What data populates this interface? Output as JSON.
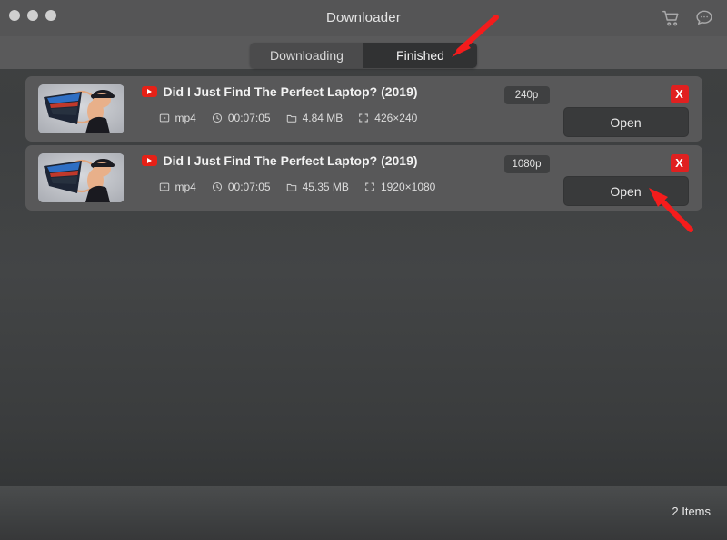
{
  "window": {
    "title": "Downloader",
    "traffic_lights": [
      "close",
      "minimize",
      "maximize"
    ],
    "actions": [
      {
        "name": "cart-icon",
        "label": "Cart"
      },
      {
        "name": "chat-icon",
        "label": "Chat"
      }
    ]
  },
  "tabs": [
    {
      "id": "downloading",
      "label": "Downloading",
      "active": false
    },
    {
      "id": "finished",
      "label": "Finished",
      "active": true
    }
  ],
  "downloads": [
    {
      "title": "Did I Just Find The Perfect Laptop? (2019)",
      "source": "youtube",
      "format": "mp4",
      "duration": "00:07:05",
      "size": "4.84 MB",
      "resolution": "426×240",
      "quality": "240p",
      "open_label": "Open",
      "close_label": "X"
    },
    {
      "title": "Did I Just Find The Perfect Laptop? (2019)",
      "source": "youtube",
      "format": "mp4",
      "duration": "00:07:05",
      "size": "45.35 MB",
      "resolution": "1920×1080",
      "quality": "1080p",
      "open_label": "Open",
      "close_label": "X"
    }
  ],
  "statusbar": {
    "item_count": "2 Items"
  },
  "annotations": [
    {
      "name": "arrow-to-finished-tab",
      "color": "#f41c1c"
    },
    {
      "name": "arrow-to-open-button",
      "color": "#f41c1c"
    }
  ],
  "colors": {
    "accent_red": "#e02020",
    "youtube_red": "#e62117",
    "titlebar": "#555556",
    "tabbar": "#5a5a5b",
    "card": "#585859",
    "tab_active": "#313233",
    "arrow": "#f41c1c"
  }
}
